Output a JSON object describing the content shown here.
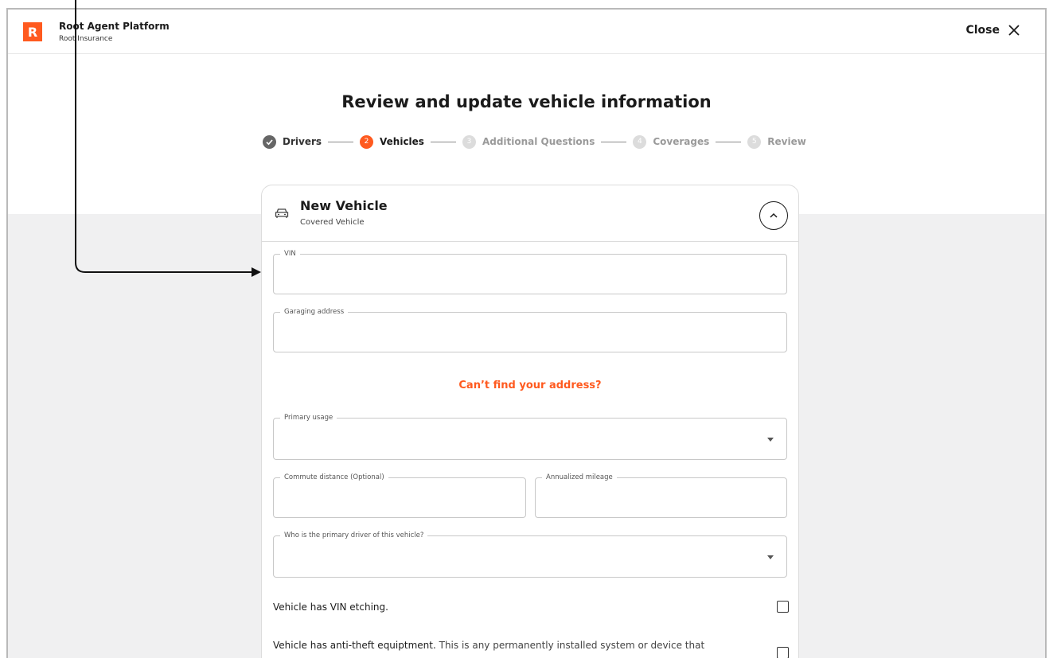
{
  "header": {
    "logo_letter": "R",
    "app_title": "Root Agent Platform",
    "app_subtitle": "Root Insurance",
    "close_label": "Close"
  },
  "page": {
    "title": "Review and update vehicle information"
  },
  "stepper": {
    "steps": [
      {
        "number": "",
        "label": "Drivers",
        "state": "done"
      },
      {
        "number": "2",
        "label": "Vehicles",
        "state": "active"
      },
      {
        "number": "3",
        "label": "Additional Questions",
        "state": "todo"
      },
      {
        "number": "4",
        "label": "Coverages",
        "state": "todo"
      },
      {
        "number": "5",
        "label": "Review",
        "state": "todo"
      }
    ]
  },
  "vehicle_card": {
    "title": "New Vehicle",
    "subtitle": "Covered Vehicle",
    "fields": {
      "vin": {
        "label": "VIN",
        "value": ""
      },
      "garaging_address": {
        "label": "Garaging address",
        "value": ""
      },
      "primary_usage": {
        "label": "Primary usage",
        "value": ""
      },
      "commute_distance": {
        "label": "Commute distance (Optional)",
        "value": ""
      },
      "annualized_mileage": {
        "label": "Annualized mileage",
        "value": ""
      },
      "primary_driver": {
        "label": "Who is the primary driver of this vehicle?",
        "value": ""
      }
    },
    "address_link": "Can’t find your address?",
    "checks": {
      "vin_etching": {
        "label": "Vehicle has VIN etching.",
        "checked": false
      },
      "anti_theft": {
        "label": "Vehicle has anti-theft equiptment.",
        "detail": "This is any permanently installed system or device that",
        "checked": false
      }
    }
  },
  "colors": {
    "accent": "#ff5a1f",
    "background_gray": "#f0f0f1",
    "text": "#1b1b1b"
  }
}
